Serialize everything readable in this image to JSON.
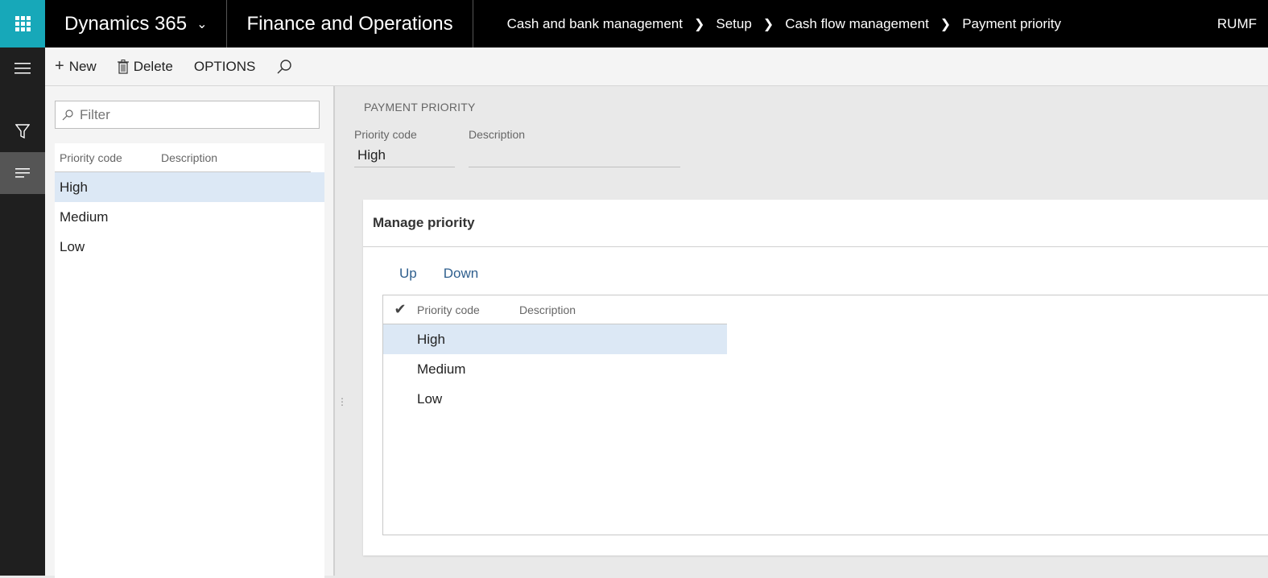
{
  "topbar": {
    "brand": "Dynamics 365",
    "module": "Finance and Operations",
    "breadcrumb": [
      "Cash and bank management",
      "Setup",
      "Cash flow management",
      "Payment priority"
    ],
    "company": "RUMF",
    "accent_color": "#17a8b9"
  },
  "actions": {
    "new": "New",
    "delete": "Delete",
    "options": "OPTIONS"
  },
  "left_list": {
    "filter_placeholder": "Filter",
    "columns": [
      "Priority code",
      "Description"
    ],
    "rows": [
      {
        "code": "High",
        "description": "",
        "selected": true
      },
      {
        "code": "Medium",
        "description": ""
      },
      {
        "code": "Low",
        "description": ""
      }
    ]
  },
  "details": {
    "section_title": "PAYMENT PRIORITY",
    "priority_code_label": "Priority code",
    "priority_code_value": "High",
    "description_label": "Description",
    "description_value": ""
  },
  "manage_priority": {
    "title": "Manage priority",
    "up": "Up",
    "down": "Down",
    "columns": [
      "Priority code",
      "Description"
    ],
    "rows": [
      {
        "code": "High",
        "description": "",
        "selected": true
      },
      {
        "code": "Medium",
        "description": ""
      },
      {
        "code": "Low",
        "description": ""
      }
    ]
  }
}
